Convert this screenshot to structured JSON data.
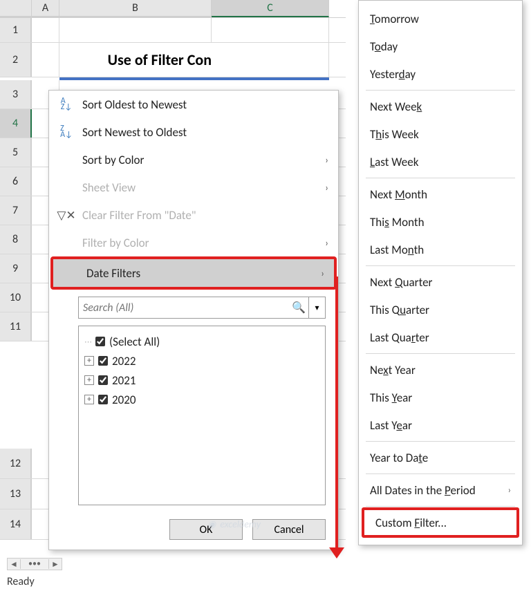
{
  "columns": {
    "A": "A",
    "B": "B",
    "C": "C"
  },
  "rows": [
    "1",
    "2",
    "3",
    "4",
    "5",
    "6",
    "7",
    "8",
    "9",
    "10",
    "11",
    "12",
    "13",
    "14"
  ],
  "title": "Use of Filter Con",
  "dropdown": {
    "sort_oldest_pre": "S",
    "sort_oldest": "ort Oldest to Newest",
    "sort_newest_pre": "S",
    "sort_newest": "ort Newest to Oldest",
    "sort_color_pre": "Sor",
    "sort_color": "t by Color",
    "sheet_view_pre": "Sheet ",
    "sheet_view": "View",
    "clear_filter_pre": "",
    "clear_filter": "Clear Filter From \"Date\"",
    "filter_color_pre": "F",
    "filter_color": "ilter by Color",
    "date_filters_pre": "Date ",
    "date_filters": "Filters",
    "search_placeholder": "Search (All)",
    "tree": {
      "select_all": "(Select All)",
      "y2022": "2022",
      "y2021": "2021",
      "y2020": "2020"
    },
    "ok": "OK",
    "cancel": "Cancel"
  },
  "submenu": {
    "tomorrow": "Tomorrow",
    "tomorrow_u": "T",
    "today": "oday",
    "today_u": "T",
    "yesterday_pre": "Yester",
    "yesterday_u": "d",
    "yesterday_post": "ay",
    "nextweek_pre": "Next Wee",
    "nextweek_u": "k",
    "thisweek_pre": "T",
    "thisweek_u": "h",
    "thisweek_post": "is Week",
    "lastweek_u": "L",
    "lastweek_post": "ast Week",
    "nextmonth_pre": "Next ",
    "nextmonth_u": "M",
    "nextmonth_post": "onth",
    "thismonth_pre": "Thi",
    "thismonth_u": "s",
    "thismonth_post": " Month",
    "lastmonth_pre": "Last Mo",
    "lastmonth_u": "n",
    "lastmonth_post": "th",
    "nextquarter_pre": "Next ",
    "nextquarter_u": "Q",
    "nextquarter_post": "uarter",
    "thisquarter_pre": "This Q",
    "thisquarter_u": "u",
    "thisquarter_post": "arter",
    "lastquarter_pre": "Last Qua",
    "lastquarter_u": "r",
    "lastquarter_post": "ter",
    "nextyear_pre": "Ne",
    "nextyear_u": "x",
    "nextyear_post": "t Year",
    "thisyear_pre": "This ",
    "thisyear_u": "Y",
    "thisyear_post": "ear",
    "lastyear_pre": "Last Y",
    "lastyear_u": "e",
    "lastyear_post": "ar",
    "ytd_pre": "Year to Da",
    "ytd_u": "t",
    "ytd_post": "e",
    "allperiod_pre": "All Dates in the ",
    "allperiod_u": "P",
    "allperiod_post": "eriod",
    "custom_pre": "Custom ",
    "custom_u": "F",
    "custom_post": "ilter..."
  },
  "status": {
    "ready": "Ready"
  },
  "watermark": "exceldemy"
}
